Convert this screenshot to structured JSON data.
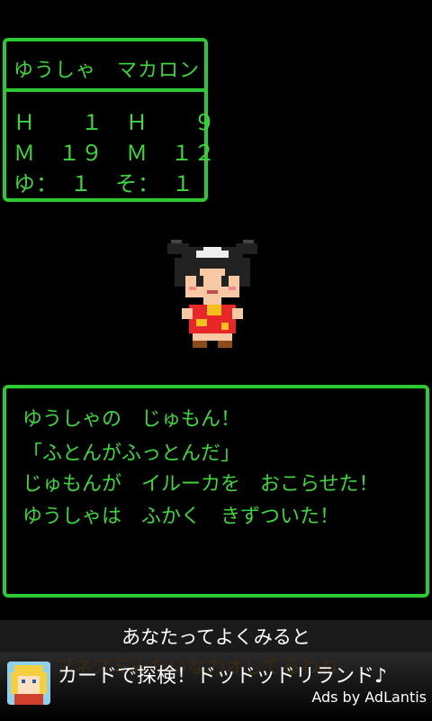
{
  "status": {
    "title": "ゆうしゃ　マカロン",
    "rows": [
      "Ｈ　　１　Ｈ　　９",
      "Ｍ　１９　Ｍ　１２",
      "ゆ：　１　そ：　１"
    ]
  },
  "message": {
    "lines": [
      "ゆうしゃの　じゅもん！",
      "「ふとんがふっとんだ」",
      "じゅもんが　イルーカを　おこらせた！",
      "ゆうしゃは　ふかく　きずついた！"
    ]
  },
  "ad": {
    "caption": "あなたってよくみると",
    "ghost_text": "ドブネズミみたいな力オしてるわね",
    "title": "カードで探検！ドッドッドリランド♪",
    "credit": "Ads by AdLantis"
  },
  "colors": {
    "window_border": "#2cc932",
    "text_green": "#3ad83a",
    "background": "#000000"
  },
  "sprite": {
    "icon": "hero-girl-sprite"
  }
}
